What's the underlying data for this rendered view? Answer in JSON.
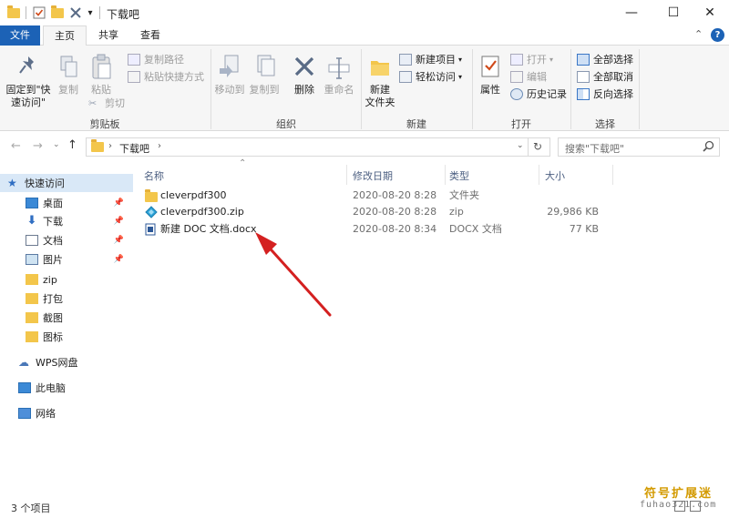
{
  "window": {
    "title": "下载吧",
    "minimize": "—",
    "maximize": "☐",
    "close": "✕",
    "help": "?",
    "collapse": "⌃"
  },
  "tabs": [
    {
      "label": "文件"
    },
    {
      "label": "主页"
    },
    {
      "label": "共享"
    },
    {
      "label": "查看"
    }
  ],
  "ribbon": {
    "clipboard": {
      "label": "剪贴板",
      "pin_quick_l1": "固定到\"快",
      "pin_quick_l2": "速访问\"",
      "copy": "复制",
      "paste": "粘贴",
      "copy_path": "复制路径",
      "paste_shortcut": "粘贴快捷方式",
      "cut": "剪切"
    },
    "organize": {
      "label": "组织",
      "move_to": "移动到",
      "copy_to": "复制到",
      "delete": "删除",
      "rename": "重命名"
    },
    "new": {
      "label": "新建",
      "new_folder_l1": "新建",
      "new_folder_l2": "文件夹",
      "new_item": "新建项目",
      "easy_access": "轻松访问"
    },
    "open": {
      "label": "打开",
      "properties": "属性",
      "open": "打开",
      "edit": "编辑",
      "history": "历史记录"
    },
    "select": {
      "label": "选择",
      "select_all": "全部选择",
      "select_none": "全部取消",
      "invert": "反向选择"
    }
  },
  "address": {
    "path": "下载吧",
    "search_placeholder": "搜索\"下载吧\""
  },
  "nav": {
    "quick_access": "快速访问",
    "items": [
      {
        "label": "桌面",
        "pinned": true
      },
      {
        "label": "下载",
        "pinned": true
      },
      {
        "label": "文档",
        "pinned": true
      },
      {
        "label": "图片",
        "pinned": true
      },
      {
        "label": "zip",
        "pinned": false
      },
      {
        "label": "打包",
        "pinned": false
      },
      {
        "label": "截图",
        "pinned": false
      },
      {
        "label": "图标",
        "pinned": false
      }
    ],
    "wps": "WPS网盘",
    "this_pc": "此电脑",
    "network": "网络"
  },
  "columns": {
    "name": "名称",
    "date": "修改日期",
    "type": "类型",
    "size": "大小"
  },
  "files": [
    {
      "name": "cleverpdf300",
      "date": "2020-08-20 8:28",
      "type": "文件夹",
      "size": "",
      "icon": "folder-icon"
    },
    {
      "name": "cleverpdf300.zip",
      "date": "2020-08-20 8:28",
      "type": "zip",
      "size": "29,986 KB",
      "icon": "zip-icon"
    },
    {
      "name": "新建 DOC 文档.docx",
      "date": "2020-08-20 8:34",
      "type": "DOCX 文档",
      "size": "77 KB",
      "icon": "docx-icon"
    }
  ],
  "status": {
    "item_count": "3 个项目"
  },
  "watermark": {
    "line1": "符号扩展迷",
    "line2": "fuhao321.com"
  },
  "colors": {
    "accent": "#1c62b6",
    "folder": "#f3c64b",
    "arrow": "#d42020",
    "watermark": "#d39a00"
  }
}
